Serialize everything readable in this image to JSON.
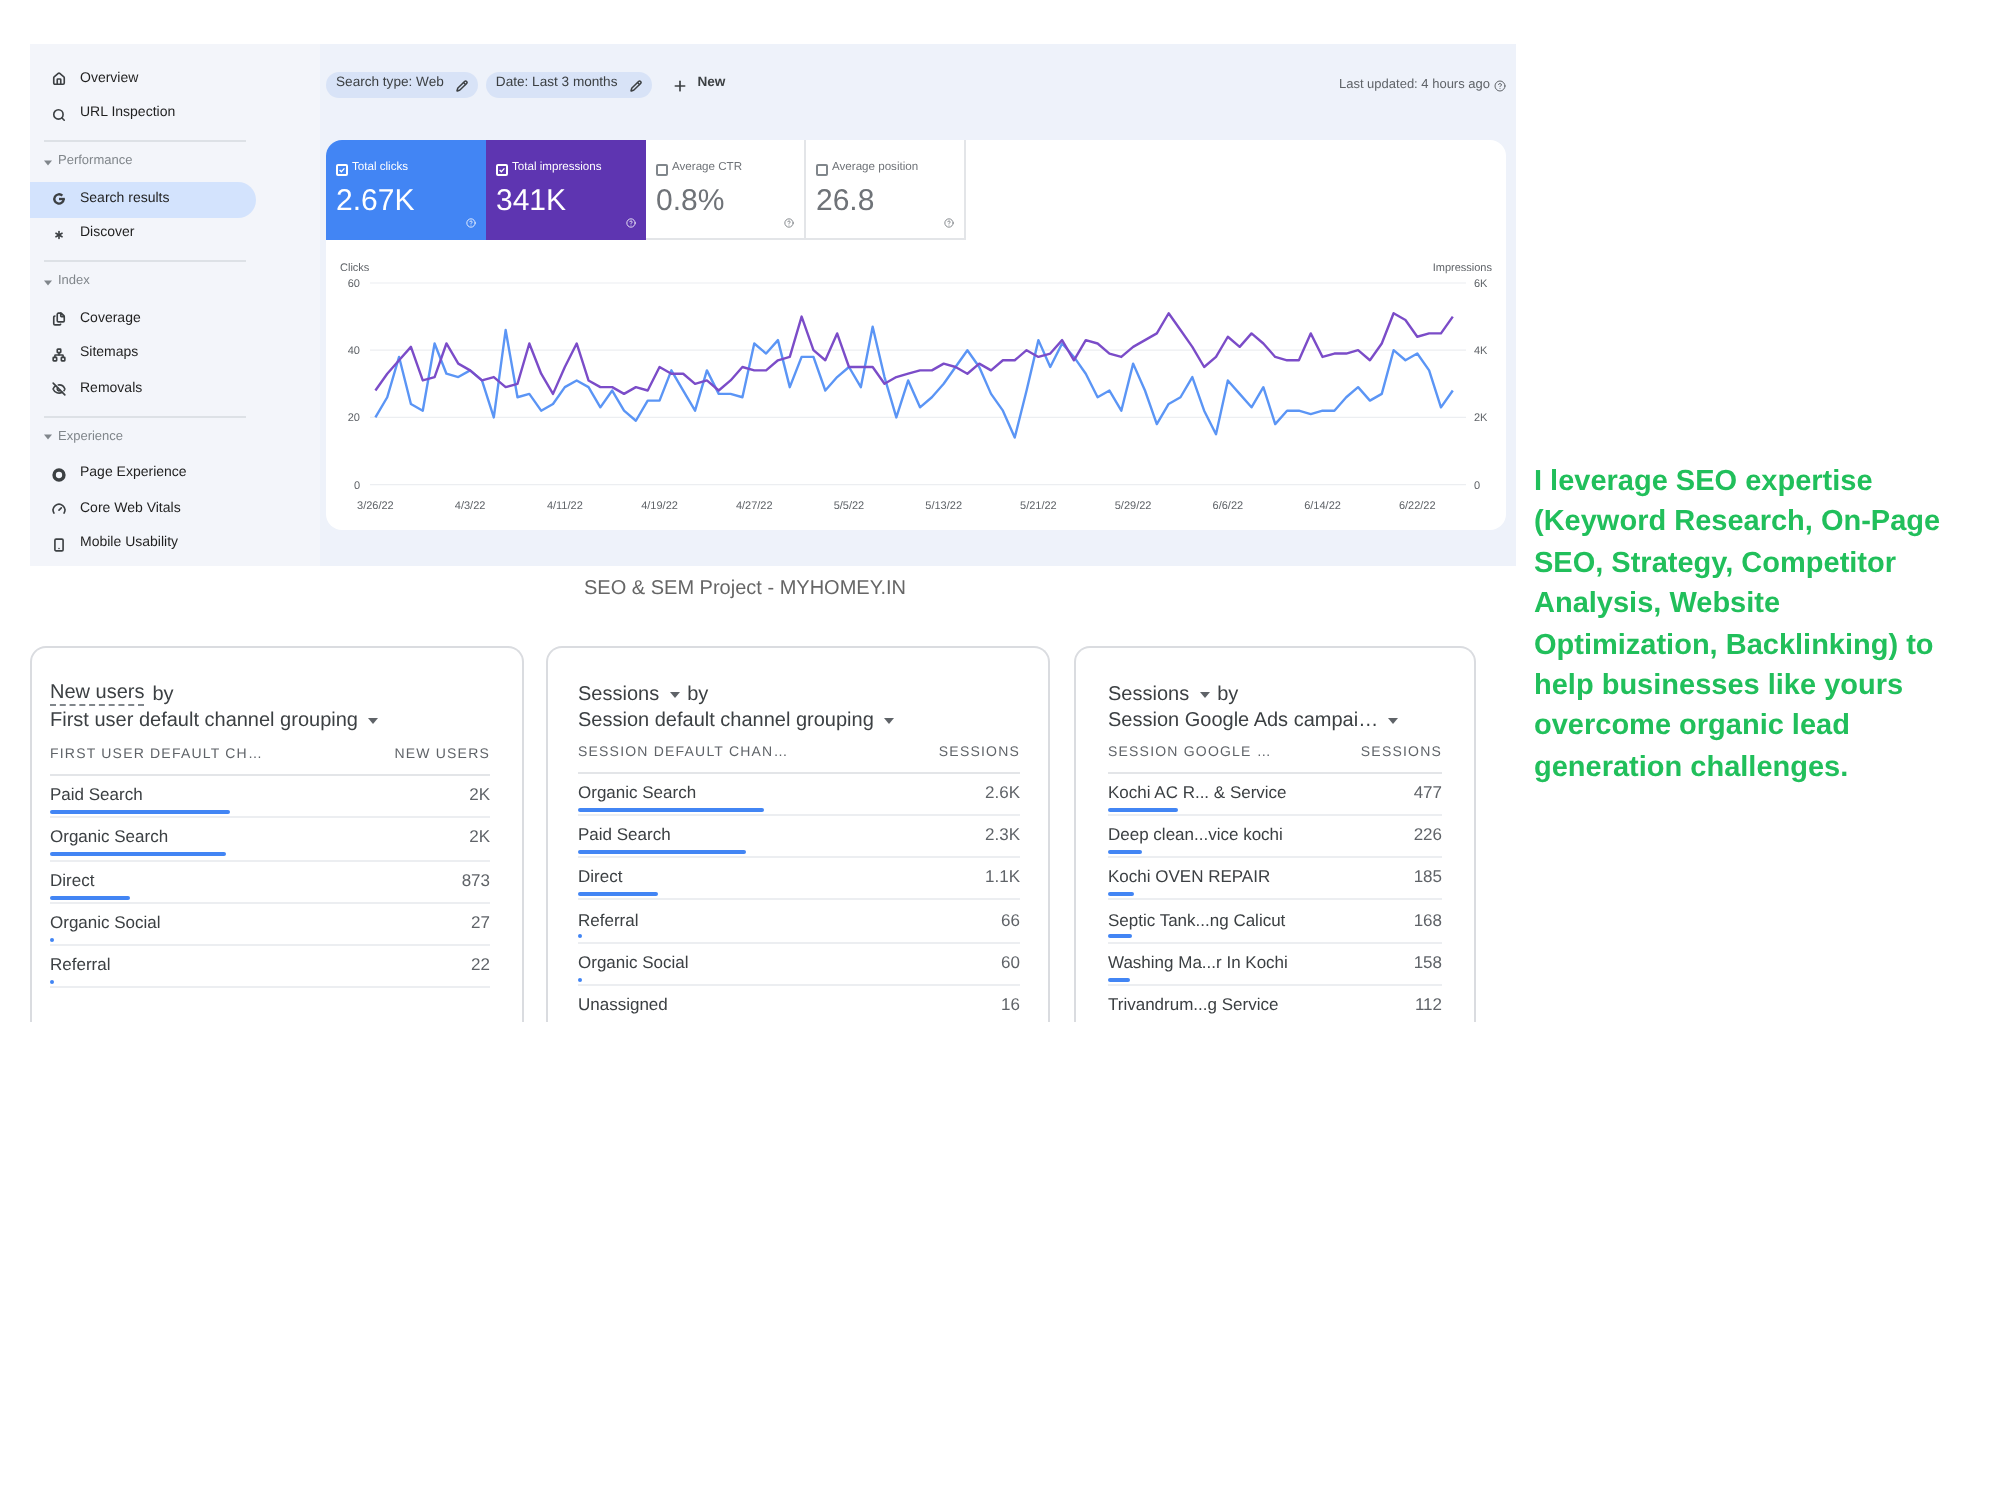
{
  "sidebar": {
    "top_items": [
      {
        "label": "Overview",
        "selected": false
      },
      {
        "label": "URL Inspection",
        "selected": false
      }
    ],
    "sections": [
      {
        "title": "Performance",
        "expanded": true,
        "items": [
          {
            "label": "Search results",
            "selected": true
          },
          {
            "label": "Discover",
            "selected": false
          }
        ]
      },
      {
        "title": "Index",
        "expanded": true,
        "items": [
          {
            "label": "Coverage",
            "selected": false
          },
          {
            "label": "Sitemaps",
            "selected": false
          },
          {
            "label": "Removals",
            "selected": false
          }
        ]
      },
      {
        "title": "Experience",
        "expanded": true,
        "items": [
          {
            "label": "Page Experience",
            "selected": false
          },
          {
            "label": "Core Web Vitals",
            "selected": false
          },
          {
            "label": "Mobile Usability",
            "selected": false
          }
        ]
      }
    ]
  },
  "filters": {
    "chips": [
      {
        "label": "Search type: Web"
      },
      {
        "label": "Date: Last 3 months"
      }
    ],
    "new_button": "New",
    "last_updated": "Last updated: 4 hours ago"
  },
  "metrics": [
    {
      "label": "Total clicks",
      "value": "2.67K",
      "checked": true,
      "color": "#4285f4"
    },
    {
      "label": "Total impressions",
      "value": "341K",
      "checked": true,
      "color": "#5e35b1"
    },
    {
      "label": "Average CTR",
      "value": "0.8%",
      "checked": false
    },
    {
      "label": "Average position",
      "value": "26.8",
      "checked": false
    }
  ],
  "performance_chart": {
    "chart_data": {
      "type": "line",
      "ylabel": "Clicks",
      "y2label": "Impressions",
      "categories": [
        "3/26/22",
        null,
        null,
        null,
        null,
        null,
        null,
        null,
        "4/3/22",
        null,
        null,
        null,
        null,
        null,
        null,
        null,
        "4/11/22",
        null,
        null,
        null,
        null,
        null,
        null,
        null,
        "4/19/22",
        null,
        null,
        null,
        null,
        null,
        null,
        null,
        "4/27/22",
        null,
        null,
        null,
        null,
        null,
        null,
        null,
        "5/5/22",
        null,
        null,
        null,
        null,
        null,
        null,
        null,
        "5/13/22",
        null,
        null,
        null,
        null,
        null,
        null,
        null,
        "5/21/22",
        null,
        null,
        null,
        null,
        null,
        null,
        null,
        "5/29/22",
        null,
        null,
        null,
        null,
        null,
        null,
        null,
        "6/6/22",
        null,
        null,
        null,
        null,
        null,
        null,
        null,
        "6/14/22",
        null,
        null,
        null,
        null,
        null,
        null,
        null,
        "6/22/22",
        null,
        null,
        null
      ],
      "ylim": [
        0,
        60
      ],
      "yticks": [
        0,
        20,
        40,
        60
      ],
      "y2lim": [
        0,
        6000
      ],
      "y2ticks": [
        {
          "value": 0,
          "label": "0"
        },
        {
          "value": 2000,
          "label": "2K"
        },
        {
          "value": 4000,
          "label": "4K"
        },
        {
          "value": 6000,
          "label": "6K"
        }
      ],
      "series": [
        {
          "color": "#5b95f5",
          "values": [
            20,
            26,
            38,
            24,
            22,
            42,
            33,
            32,
            34,
            31,
            20,
            46,
            26,
            27,
            22,
            24,
            29,
            31,
            29,
            23,
            28,
            22,
            19,
            25,
            25,
            34,
            28,
            22,
            34,
            27,
            27,
            26,
            42,
            39,
            43,
            29,
            38,
            38,
            28,
            32,
            35,
            29,
            47,
            32,
            20,
            31,
            23,
            26,
            30,
            35,
            40,
            35,
            27,
            22,
            14,
            28,
            43,
            35,
            42,
            38,
            33,
            26,
            28,
            22,
            36,
            28,
            18,
            24,
            26,
            32,
            22,
            15,
            31,
            27,
            23,
            29,
            18,
            22,
            22,
            21,
            22,
            22,
            26,
            29,
            25,
            27,
            40,
            37,
            39,
            34,
            23,
            28
          ]
        },
        {
          "color": "#7b4cc8",
          "axis": "y2",
          "values": [
            2800,
            3300,
            3700,
            4100,
            3100,
            3200,
            4200,
            3600,
            3400,
            3100,
            3200,
            2900,
            3000,
            4200,
            3300,
            2700,
            3500,
            4200,
            3100,
            2900,
            2900,
            2700,
            2900,
            2800,
            3500,
            3300,
            3300,
            3000,
            3100,
            2800,
            3100,
            3500,
            3400,
            3400,
            3700,
            3800,
            5000,
            4000,
            3700,
            4500,
            3500,
            3500,
            3500,
            3000,
            3200,
            3300,
            3400,
            3400,
            3600,
            3500,
            3300,
            3600,
            3400,
            3700,
            3700,
            4000,
            3800,
            3900,
            4300,
            3700,
            4300,
            4200,
            3900,
            3800,
            4100,
            4300,
            4500,
            5100,
            4600,
            4100,
            3500,
            3800,
            4400,
            4100,
            4500,
            4200,
            3800,
            3700,
            3700,
            4500,
            3800,
            3900,
            3900,
            4000,
            3700,
            4200,
            5100,
            4900,
            4400,
            4500,
            4500,
            5000
          ]
        }
      ]
    }
  },
  "caption": "SEO & SEM Project - MYHOMEY.IN",
  "report_cards": [
    {
      "metric": {
        "label": "New users",
        "dropdown": false
      },
      "by": "by",
      "dimension": "First user default channel grouping",
      "columns": [
        "FIRST USER DEFAULT CH…",
        "NEW USERS"
      ],
      "rows": [
        {
          "label": "Paid Search",
          "value": "2K",
          "level": 0.41
        },
        {
          "label": "Organic Search",
          "value": "2K",
          "level": 0.4
        },
        {
          "label": "Direct",
          "value": "873",
          "level": 0.18
        },
        {
          "label": "Organic Social",
          "value": "27",
          "level": 0.01
        },
        {
          "label": "Referral",
          "value": "22",
          "level": 0.01
        }
      ]
    },
    {
      "metric": {
        "label": "Sessions",
        "dropdown": true
      },
      "by": "by",
      "dimension": "Session default channel grouping",
      "columns": [
        "SESSION DEFAULT CHAN…",
        "SESSIONS"
      ],
      "rows": [
        {
          "label": "Organic Search",
          "value": "2.6K",
          "level": 0.42
        },
        {
          "label": "Paid Search",
          "value": "2.3K",
          "level": 0.38
        },
        {
          "label": "Direct",
          "value": "1.1K",
          "level": 0.18
        },
        {
          "label": "Referral",
          "value": "66",
          "level": 0.01
        },
        {
          "label": "Organic Social",
          "value": "60",
          "level": 0.01
        },
        {
          "label": "Unassigned",
          "value": "16"
        }
      ]
    },
    {
      "metric": {
        "label": "Sessions",
        "dropdown": true
      },
      "by": "by",
      "dimension": "Session Google Ads campai…",
      "columns": [
        "SESSION GOOGLE …",
        "SESSIONS"
      ],
      "rows": [
        {
          "label": "Kochi AC R... & Service",
          "value": "477",
          "level": 0.21
        },
        {
          "label": "Deep clean...vice kochi",
          "value": "226",
          "level": 0.1
        },
        {
          "label": "Kochi OVEN REPAIR",
          "value": "185",
          "level": 0.08
        },
        {
          "label": "Septic Tank...ng Calicut",
          "value": "168",
          "level": 0.07
        },
        {
          "label": "Washing Ma...r In Kochi",
          "value": "158",
          "level": 0.065
        },
        {
          "label": "Trivandrum...g Service",
          "value": "112"
        }
      ]
    }
  ],
  "promo_text": {
    "lines": [
      "I leverage SEO expertise",
      "(Keyword Research, On-Page",
      "SEO, Strategy, Competitor",
      "Analysis, Website",
      "Optimization, Backlinking) to",
      "help businesses like yours",
      "overcome organic lead",
      "generation challenges."
    ]
  }
}
